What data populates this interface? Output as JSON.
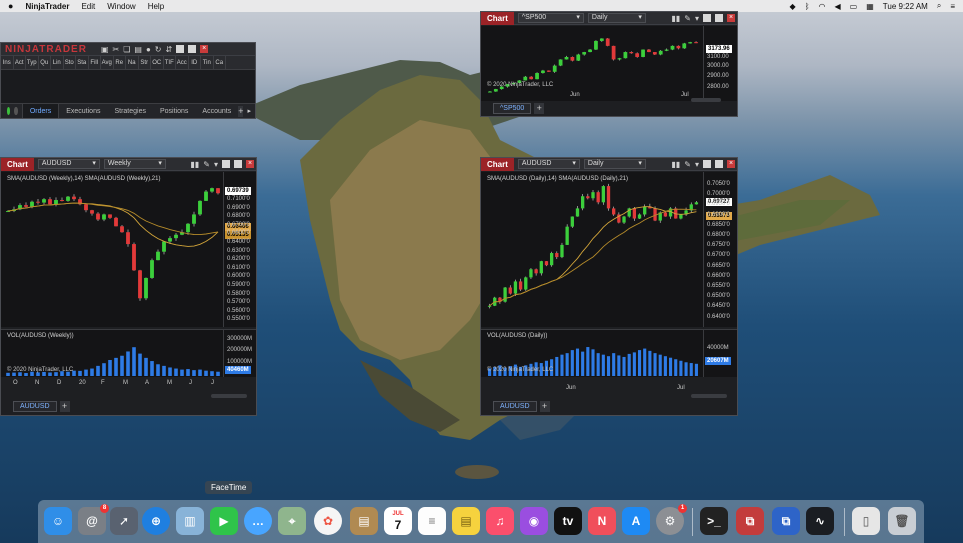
{
  "menubar": {
    "apple": "",
    "app": "NinjaTrader",
    "items": [
      "Edit",
      "Window",
      "Help"
    ],
    "clock": "Tue 9:22 AM"
  },
  "control_center": {
    "logo": "NINJATRADER",
    "columns": [
      "Ins",
      "Act",
      "Typ",
      "Qu",
      "Lin",
      "Sto",
      "Sta",
      "Fill",
      "Avg",
      "Re",
      "Na",
      "Str",
      "OC",
      "TIF",
      "Acc",
      "ID",
      "Tin",
      "Ca"
    ],
    "tabs": [
      "Orders",
      "Executions",
      "Strategies",
      "Positions",
      "Accounts"
    ],
    "add": "+"
  },
  "chart_sp500": {
    "tab": "Chart",
    "instrument": "^SP500",
    "period": "Daily",
    "copyright": "© 2020 NinjaTrader, LLC",
    "price_labels": [
      "3100.00",
      "3000.00",
      "2900.00",
      "2800.00"
    ],
    "last_price": "3173.96",
    "x_labels": [
      "Jun",
      "Jul"
    ],
    "bottom_tab": "^SP500",
    "add": "+"
  },
  "chart_audusd_weekly": {
    "tab": "Chart",
    "instrument": "AUDUSD",
    "period": "Weekly",
    "indicators": "SMA(AUDUSD (Weekly),14)  SMA(AUDUSD (Weekly),21)",
    "volume_label": "VOL(AUDUSD (Weekly))",
    "copyright": "© 2020 NinjaTrader, LLC",
    "price_labels": [
      "0.7100'0",
      "0.6900'0",
      "0.6800'0",
      "0.6700'0",
      "0.6600'0",
      "0.6400'0",
      "0.6300'0",
      "0.6200'0",
      "0.6100'0",
      "0.6000'0",
      "0.5900'0",
      "0.5800'0",
      "0.5700'0",
      "0.5600'0",
      "0.5500'0"
    ],
    "last_price": "0.69739",
    "sma_labels": [
      "0.66466",
      "0.65135"
    ],
    "volume_labels": [
      "300000M",
      "200000M",
      "100000M"
    ],
    "volume_last": "40460M",
    "x_labels": [
      "O",
      "N",
      "D",
      "20",
      "F",
      "M",
      "A",
      "M",
      "J",
      "J"
    ],
    "bottom_tab": "AUDUSD",
    "add": "+"
  },
  "chart_audusd_daily": {
    "tab": "Chart",
    "instrument": "AUDUSD",
    "period": "Daily",
    "indicators": "SMA(AUDUSD (Daily),14)  SMA(AUDUSD (Daily),21)",
    "volume_label": "VOL(AUDUSD (Daily))",
    "copyright": "© 2020 NinjaTrader, LLC",
    "price_labels": [
      "0.7050'0",
      "0.7000'0",
      "0.6950'0",
      "0.6900'0",
      "0.6850'0",
      "0.6800'0",
      "0.6750'0",
      "0.6700'0",
      "0.6650'0",
      "0.6600'0",
      "0.6550'0",
      "0.6500'0",
      "0.6450'0",
      "0.6400'0"
    ],
    "last_price": "0.69727",
    "sma_label": "0.68873",
    "volume_labels": [
      "40000M"
    ],
    "volume_last": "20607M",
    "x_labels": [
      "Jun",
      "Jul"
    ],
    "bottom_tab": "AUDUSD",
    "add": "+"
  },
  "dock": {
    "tooltip": "FaceTime",
    "calendar_month": "JUL",
    "calendar_day": "7",
    "badge_contacts": "8",
    "badge_prefs": "1"
  },
  "colors": {
    "accent_red": "#9b2327",
    "candle_up": "#3ccf3c",
    "candle_down": "#e23a3a",
    "volume": "#2e7be6",
    "sma_fast": "#d4a63a",
    "sma_slow": "#b58b2a"
  }
}
